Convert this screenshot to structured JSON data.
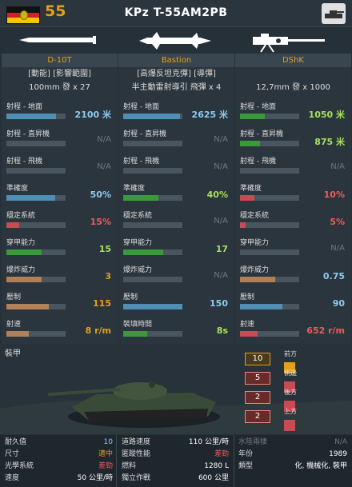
{
  "header": {
    "cost": "55",
    "unit_name": "KPz T-55AM2PB",
    "flag": "east-germany-flag",
    "category_icon": "tank-icon"
  },
  "colors": {
    "cost": "#e2a019",
    "blue": "#4f8fb6",
    "green": "#3a9a3a",
    "red": "#c84a52",
    "tan": "#b08058"
  },
  "weapons": [
    {
      "name": "D-10T",
      "tags": "[動能] [影響範圍]",
      "ammo": "100mm 發 x 27",
      "stats": [
        {
          "label": "射程 - 地面",
          "value": "2100 米",
          "fill": 0.84,
          "color": "bl",
          "vclass": "vbl"
        },
        {
          "label": "射程 - 直昇機",
          "value": "N/A",
          "fill": 0,
          "color": "",
          "vclass": "dim"
        },
        {
          "label": "射程 - 飛機",
          "value": "N/A",
          "fill": 0,
          "color": "",
          "vclass": "dim"
        },
        {
          "label": "準確度",
          "value": "50%",
          "fill": 0.82,
          "color": "bl",
          "vclass": "vbl"
        },
        {
          "label": "穩定系統",
          "value": "15%",
          "fill": 0.22,
          "color": "rd",
          "vclass": "vrd"
        },
        {
          "label": "穿甲能力",
          "value": "15",
          "fill": 0.6,
          "color": "gr",
          "vclass": "vgr"
        },
        {
          "label": "爆炸威力",
          "value": "3",
          "fill": 0.6,
          "color": "tn",
          "vclass": "vor"
        },
        {
          "label": "壓制",
          "value": "115",
          "fill": 0.72,
          "color": "tn",
          "vclass": "vor"
        },
        {
          "label": "射速",
          "value": "8 r/m",
          "fill": 0.38,
          "color": "tn",
          "vclass": "vor"
        }
      ]
    },
    {
      "name": "Bastion",
      "tags": "[高爆反坦克彈] [導彈]",
      "ammo": "半主動雷射導引 飛彈 x 4",
      "stats": [
        {
          "label": "射程 - 地面",
          "value": "2625 米",
          "fill": 0.96,
          "color": "bl",
          "vclass": "vbl"
        },
        {
          "label": "射程 - 直昇機",
          "value": "N/A",
          "fill": 0,
          "color": "",
          "vclass": "dim"
        },
        {
          "label": "射程 - 飛機",
          "value": "N/A",
          "fill": 0,
          "color": "",
          "vclass": "dim"
        },
        {
          "label": "準確度",
          "value": "40%",
          "fill": 0.6,
          "color": "gr",
          "vclass": "vgr"
        },
        {
          "label": "穩定系統",
          "value": "N/A",
          "fill": 0,
          "color": "",
          "vclass": "dim"
        },
        {
          "label": "穿甲能力",
          "value": "17",
          "fill": 0.68,
          "color": "gr",
          "vclass": "vgr"
        },
        {
          "label": "爆炸威力",
          "value": "N/A",
          "fill": 0,
          "color": "",
          "vclass": "dim"
        },
        {
          "label": "壓制",
          "value": "150",
          "fill": 1.0,
          "color": "bl",
          "vclass": "vbl"
        },
        {
          "label": "裝填時間",
          "value": "8s",
          "fill": 0.4,
          "color": "gr",
          "vclass": "vgr"
        }
      ]
    },
    {
      "name": "DShK",
      "tags": "",
      "ammo": "12,7mm 發 x 1000",
      "stats": [
        {
          "label": "射程 - 地面",
          "value": "1050 米",
          "fill": 0.42,
          "color": "gr",
          "vclass": "vgr"
        },
        {
          "label": "射程 - 直昇機",
          "value": "875 米",
          "fill": 0.34,
          "color": "gr",
          "vclass": "vgr"
        },
        {
          "label": "射程 - 飛機",
          "value": "N/A",
          "fill": 0,
          "color": "",
          "vclass": "dim"
        },
        {
          "label": "準確度",
          "value": "10%",
          "fill": 0.24,
          "color": "rd",
          "vclass": "vrd"
        },
        {
          "label": "穩定系統",
          "value": "5%",
          "fill": 0.1,
          "color": "rd",
          "vclass": "vrd"
        },
        {
          "label": "穿甲能力",
          "value": "N/A",
          "fill": 0,
          "color": "",
          "vclass": "dim"
        },
        {
          "label": "爆炸威力",
          "value": "0.75",
          "fill": 0.6,
          "color": "tn",
          "vclass": "vbl"
        },
        {
          "label": "壓制",
          "value": "90",
          "fill": 0.72,
          "color": "bl",
          "vclass": "vbl"
        },
        {
          "label": "射速",
          "value": "652 r/m",
          "fill": 0.3,
          "color": "rd",
          "vclass": "vrd"
        }
      ]
    }
  ],
  "armor": {
    "title": "裝甲",
    "values": [
      {
        "label": "前方",
        "value": "10",
        "level": "first"
      },
      {
        "label": "側邊",
        "value": "5",
        "level": ""
      },
      {
        "label": "後方",
        "value": "2",
        "level": ""
      },
      {
        "label": "上方",
        "value": "2",
        "level": ""
      }
    ]
  },
  "info": {
    "col1": [
      {
        "k": "耐久值",
        "v": "10",
        "vclass": "vbl"
      },
      {
        "k": "尺寸",
        "v": "適中",
        "vclass": "vor"
      },
      {
        "k": "光學系統",
        "v": "差勁",
        "vclass": "vrd"
      },
      {
        "k": "速度",
        "v": "50 公里/時",
        "vclass": ""
      }
    ],
    "col2": [
      {
        "k": "道路速度",
        "v": "110 公里/時",
        "vclass": ""
      },
      {
        "k": "匿蹤性能",
        "v": "差勁",
        "vclass": "vrd"
      },
      {
        "k": "燃料",
        "v": "1280 L",
        "vclass": ""
      },
      {
        "k": "獨立作戰",
        "v": "600 公里",
        "vclass": ""
      }
    ],
    "col3": [
      {
        "k": "水陸兩棲",
        "v": "N/A",
        "vclass": "dim"
      },
      {
        "k": "年份",
        "v": "1989",
        "vclass": ""
      },
      {
        "k": "類型",
        "v": "化, 機械化, 裝甲",
        "vclass": ""
      }
    ]
  }
}
